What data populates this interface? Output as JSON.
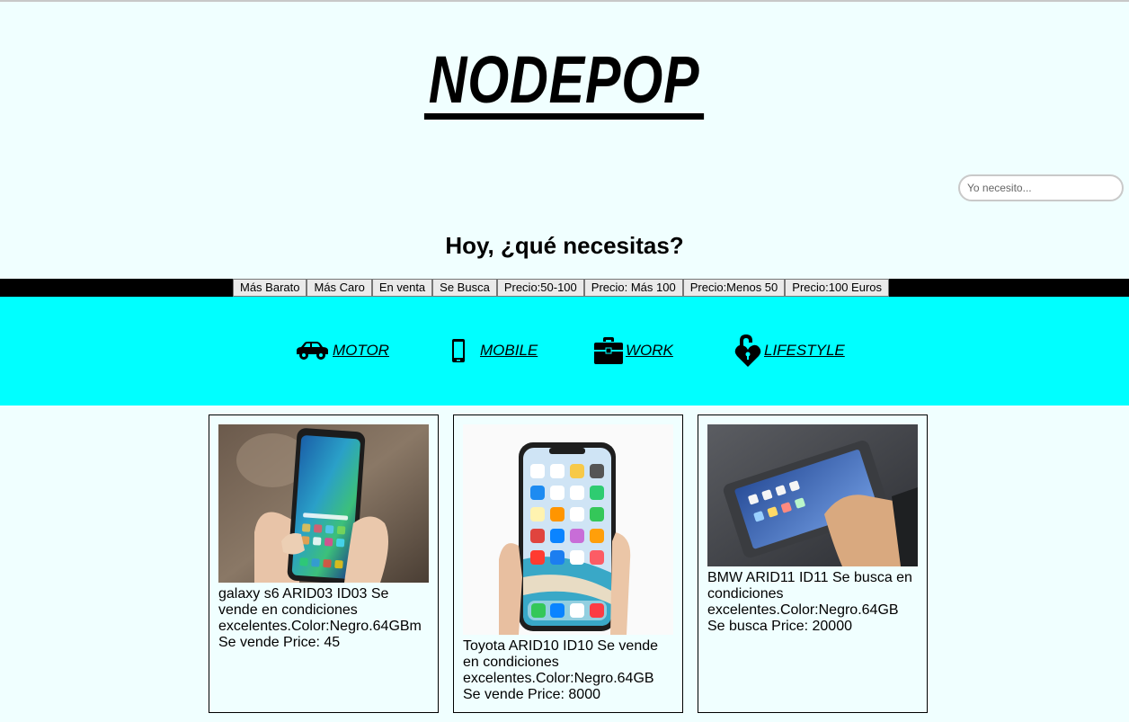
{
  "header": {
    "logo": "NODEPOP",
    "greeting": "Hoy, ¿qué necesitas?"
  },
  "search": {
    "placeholder": "Yo necesito..."
  },
  "filters": [
    "Más Barato",
    "Más Caro",
    "En venta",
    "Se Busca",
    "Precio:50-100",
    "Precio: Más 100",
    "Precio:Menos 50",
    "Precio:100 Euros"
  ],
  "categories": [
    {
      "label": "MOTOR",
      "icon": "car-icon"
    },
    {
      "label": "MOBILE",
      "icon": "mobile-phone-icon"
    },
    {
      "label": "WORK",
      "icon": "briefcase-icon"
    },
    {
      "label": "LIFESTYLE",
      "icon": "heart-lock-icon"
    }
  ],
  "products": [
    {
      "description": "galaxy s6 ARID03 ID03 Se vende en condiciones excelentes.Color:Negro.64GBm Se vende Price: 45",
      "image": "phone-in-hand-photo"
    },
    {
      "description": "Toyota ARID10 ID10 Se vende en condiciones excelentes.Color:Negro.64GB Se vende Price: 8000",
      "image": "phone-in-hand-photo"
    },
    {
      "description": "BMW ARID11 ID11 Se busca en condiciones excelentes.Color:Negro.64GB Se busca Price: 20000",
      "image": "phone-in-hand-photo"
    }
  ],
  "colors": {
    "background": "#f0ffff",
    "category_band": "#00ffff",
    "filter_bar": "#000000",
    "filter_button": "#eaeaea"
  }
}
